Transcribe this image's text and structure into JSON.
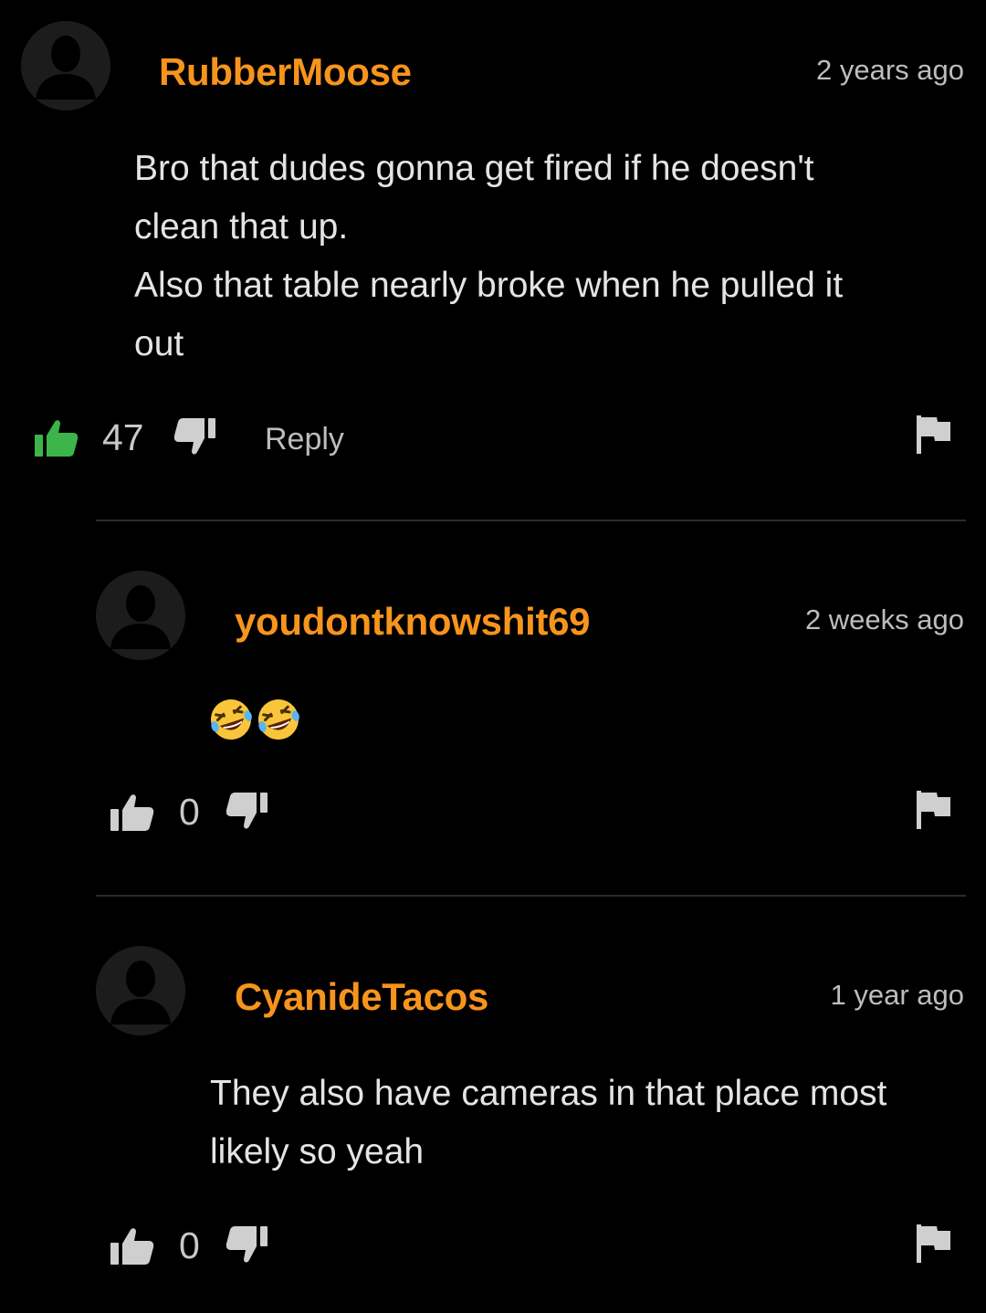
{
  "comments": [
    {
      "username": "RubberMoose",
      "timestamp": "2 years ago",
      "lines": [
        "Bro that dudes gonna get fired if he doesn't",
        "clean that up.",
        "Also that table nearly broke when he pulled it",
        "out"
      ],
      "likes": "47",
      "reply_label": "Reply",
      "liked": true
    },
    {
      "username": "youdontknowshit69",
      "timestamp": "2 weeks ago",
      "emoji": "🤣🤣",
      "likes": "0",
      "liked": false
    },
    {
      "username": "CyanideTacos",
      "timestamp": "1 year ago",
      "lines": [
        "They also have cameras in that place most",
        "likely so yeah"
      ],
      "likes": "0",
      "liked": false
    }
  ],
  "colors": {
    "background": "#000000",
    "username": "#f7941d",
    "liked": "#3bb54a",
    "icon": "#cfcfcf"
  },
  "icons": [
    "avatar-placeholder",
    "thumbs-up-icon",
    "thumbs-down-icon",
    "flag-icon",
    "rolling-on-floor-laughing-emoji"
  ]
}
